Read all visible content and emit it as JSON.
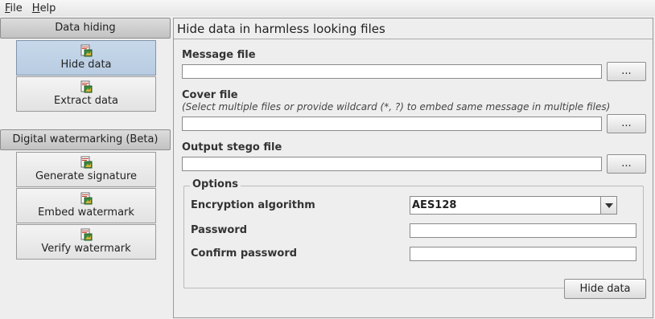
{
  "menu": {
    "file": "F",
    "file_rest": "ile",
    "help": "H",
    "help_rest": "elp"
  },
  "sidebar": {
    "group1": {
      "title": "Data hiding",
      "items": [
        {
          "label": "Hide data",
          "icon": "document-image-icon"
        },
        {
          "label": "Extract data",
          "icon": "document-image-icon"
        }
      ]
    },
    "group2": {
      "title": "Digital watermarking (Beta)",
      "items": [
        {
          "label": "Generate signature",
          "icon": "document-image-icon"
        },
        {
          "label": "Embed watermark",
          "icon": "document-image-icon"
        },
        {
          "label": "Verify watermark",
          "icon": "document-image-icon"
        }
      ]
    }
  },
  "panel": {
    "title": "Hide data in harmless looking files",
    "message_file": {
      "label": "Message file",
      "value": "",
      "browse": "..."
    },
    "cover_file": {
      "label": "Cover file",
      "hint": "(Select multiple files or provide wildcard (*, ?) to embed same message in multiple files)",
      "value": "",
      "browse": "..."
    },
    "output_file": {
      "label": "Output stego file",
      "value": "",
      "browse": "..."
    },
    "options": {
      "legend": "Options",
      "encryption_label": "Encryption algorithm",
      "encryption_value": "AES128",
      "password_label": "Password",
      "password_value": "",
      "confirm_label": "Confirm password",
      "confirm_value": ""
    },
    "action": "Hide data"
  }
}
